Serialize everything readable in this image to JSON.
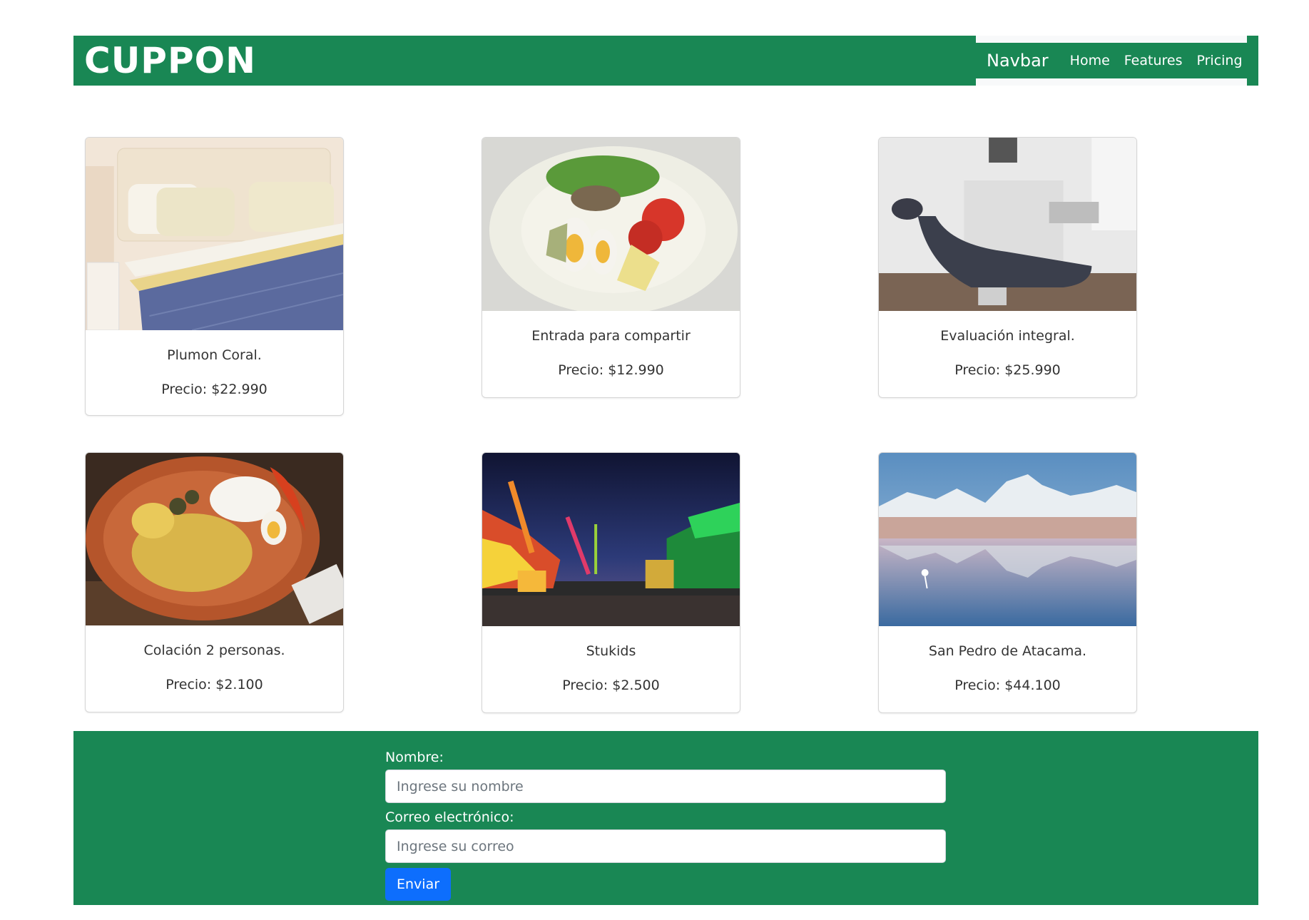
{
  "header": {
    "brand": "CUPPON",
    "navbar": {
      "brand": "Navbar",
      "links": [
        "Home",
        "Features",
        "Pricing"
      ]
    }
  },
  "cards": [
    {
      "title": "Plumon Coral.",
      "price": "Precio: $22.990",
      "image": "bed-photo"
    },
    {
      "title": "Entrada para compartir",
      "price": "Precio: $12.990",
      "image": "salad-photo"
    },
    {
      "title": "Evaluación integral.",
      "price": "Precio: $25.990",
      "image": "dental-chair-photo"
    },
    {
      "title": "Colación 2 personas.",
      "price": "Precio: $2.100",
      "image": "chicken-dish-photo"
    },
    {
      "title": "Stukids",
      "price": "Precio: $2.500",
      "image": "night-fair-photo"
    },
    {
      "title": "San Pedro de Atacama.",
      "price": "Precio: $44.100",
      "image": "atacama-landscape-photo"
    }
  ],
  "form": {
    "name_label": "Nombre:",
    "name_placeholder": "Ingrese su nombre",
    "email_label": "Correo electrónico:",
    "email_placeholder": "Ingrese su correo",
    "submit_label": "Enviar"
  },
  "colors": {
    "primary_green": "#198754",
    "button_blue": "#0d6efd"
  }
}
